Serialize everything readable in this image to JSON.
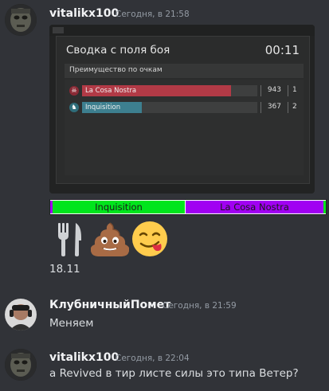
{
  "messages": [
    {
      "author": "vitalikx100",
      "timestamp": "Сегодня, в 21:58",
      "attachment": {
        "panel_title": "Сводка с поля боя",
        "timer": "00:11",
        "subheader": "Преимущество по очкам",
        "rows": [
          {
            "team": "La Cosa Nostra",
            "points": "943",
            "place": "1",
            "fill": 0.85,
            "color": "#b23a46",
            "icon": "skull-icon"
          },
          {
            "team": "Inquisition",
            "points": "367",
            "place": "2",
            "fill": 0.34,
            "color": "#3d7f8f",
            "icon": "horse-icon"
          }
        ]
      },
      "teambar": {
        "left_team": "Inquisition",
        "left_color": "#00e51c",
        "right_team": "La Cosa Nostra",
        "right_color": "#a100f2"
      },
      "emojis": [
        "fork-and-knife",
        "pile-of-poo",
        "face-savoring-food"
      ],
      "text": "18.11"
    },
    {
      "author": "КлубничныйПомет",
      "timestamp": "Сегодня, в 21:59",
      "text": "Меняем"
    },
    {
      "author": "vitalikx100",
      "timestamp": "Сегодня, в 22:04",
      "text": "а Revived в тир листе силы это типа Ветер?"
    }
  ]
}
